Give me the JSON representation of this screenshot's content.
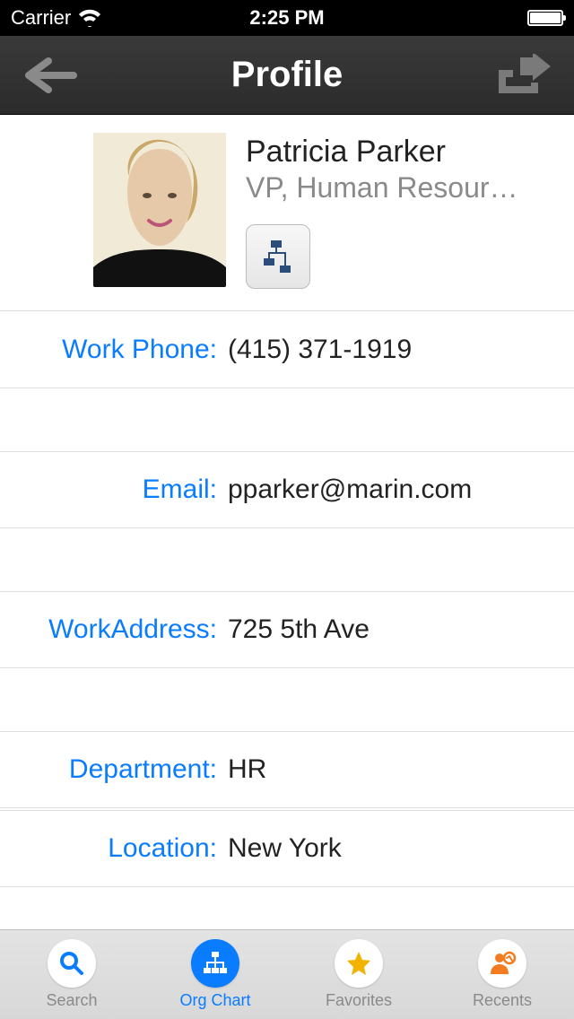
{
  "statusbar": {
    "carrier": "Carrier",
    "time": "2:25 PM"
  },
  "nav": {
    "title": "Profile"
  },
  "profile": {
    "name": "Patricia Parker",
    "title": "VP, Human Resour…"
  },
  "fields": {
    "workphone_label": "Work Phone:",
    "workphone_value": "(415) 371-1919",
    "email_label": "Email:",
    "email_value": "pparker@marin.com",
    "workaddress_label": "WorkAddress:",
    "workaddress_value": "725 5th Ave",
    "department_label": "Department:",
    "department_value": "HR",
    "location_label": "Location:",
    "location_value": "New York"
  },
  "tabs": {
    "search": "Search",
    "orgchart": "Org Chart",
    "favorites": "Favorites",
    "recents": "Recents"
  }
}
